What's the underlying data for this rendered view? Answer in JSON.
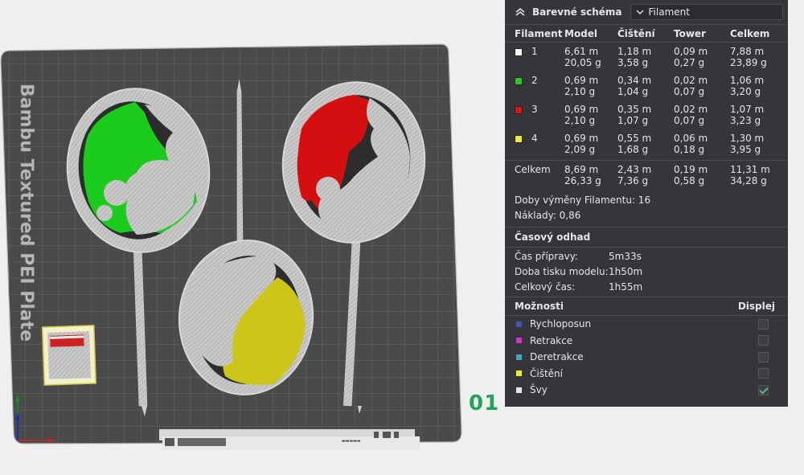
{
  "plate": {
    "label": "Bambu Textured PEI Plate",
    "number": "01"
  },
  "panel": {
    "title": "Barevné schéma",
    "dropdown_value": "Filament",
    "columns": [
      "Filament",
      "Model",
      "Čištění",
      "Tower",
      "Celkem"
    ],
    "filaments": [
      {
        "id": "1",
        "color": "#ffffff",
        "model_m": "6,61 m",
        "model_g": "20,05 g",
        "purge_m": "1,18 m",
        "purge_g": "3,58 g",
        "tower_m": "0,09 m",
        "tower_g": "0,27 g",
        "total_m": "7,88 m",
        "total_g": "23,89 g"
      },
      {
        "id": "2",
        "color": "#22cc22",
        "model_m": "0,69 m",
        "model_g": "2,10 g",
        "purge_m": "0,34 m",
        "purge_g": "1,04 g",
        "tower_m": "0,02 m",
        "tower_g": "0,07 g",
        "total_m": "1,06 m",
        "total_g": "3,20 g"
      },
      {
        "id": "3",
        "color": "#dd1111",
        "model_m": "0,69 m",
        "model_g": "2,10 g",
        "purge_m": "0,35 m",
        "purge_g": "1,07 g",
        "tower_m": "0,02 m",
        "tower_g": "0,07 g",
        "total_m": "1,07 m",
        "total_g": "3,23 g"
      },
      {
        "id": "4",
        "color": "#eeee22",
        "model_m": "0,69 m",
        "model_g": "2,09 g",
        "purge_m": "0,55 m",
        "purge_g": "1,68 g",
        "tower_m": "0,06 m",
        "tower_g": "0,18 g",
        "total_m": "1,30 m",
        "total_g": "3,95 g"
      }
    ],
    "totals": {
      "label": "Celkem",
      "model_m": "8,69 m",
      "model_g": "26,33 g",
      "purge_m": "2,43 m",
      "purge_g": "7,36 g",
      "tower_m": "0,19 m",
      "tower_g": "0,58 g",
      "total_m": "11,31 m",
      "total_g": "34,28 g"
    },
    "filament_changes": "Doby výměny Filamentu:  16",
    "cost": "Náklady: 0,86",
    "time_section": "Časový odhad",
    "times": [
      {
        "label": "Čas přípravy:",
        "value": "5m33s"
      },
      {
        "label": "Doba tisku modelu:",
        "value": "1h50m"
      },
      {
        "label": "Celkový čas:",
        "value": "1h55m"
      }
    ],
    "options_label": "Možnosti",
    "display_label": "Displej",
    "options": [
      {
        "label": "Rychloposun",
        "color": "#4055b8",
        "checked": false
      },
      {
        "label": "Retrakce",
        "color": "#cc33cc",
        "checked": false
      },
      {
        "label": "Deretrakce",
        "color": "#3fa6c8",
        "checked": false
      },
      {
        "label": "Čištění",
        "color": "#eeee22",
        "checked": false
      },
      {
        "label": "Švy",
        "color": "#e8e8e8",
        "checked": true
      }
    ]
  }
}
